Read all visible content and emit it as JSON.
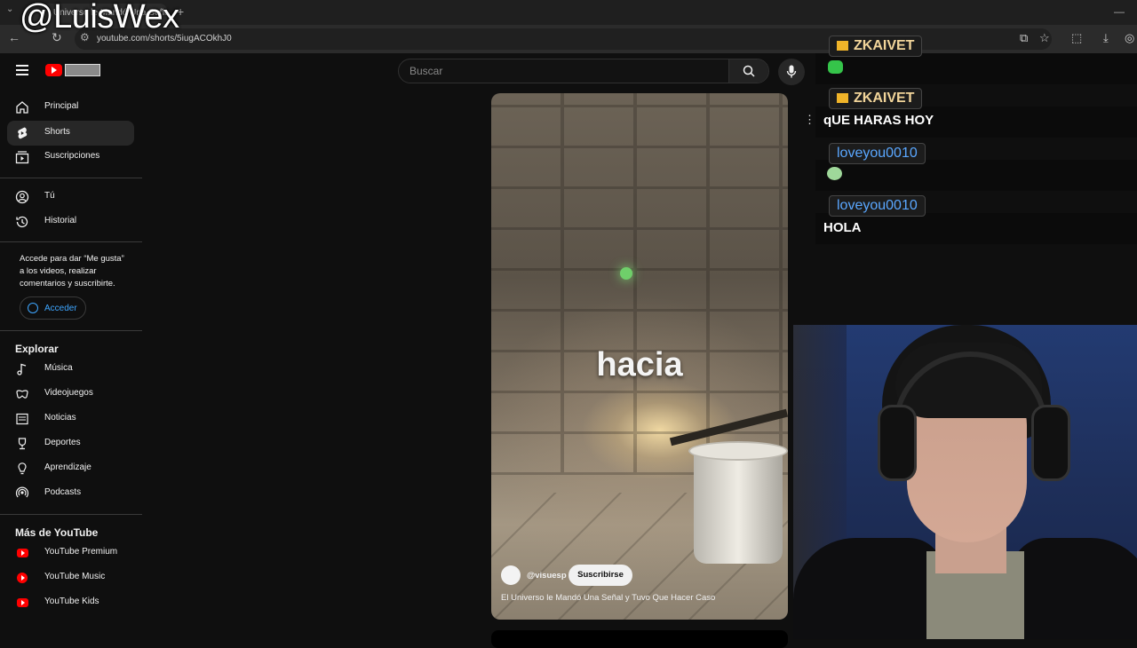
{
  "watermark": "@LuisWex",
  "browser": {
    "tab_title": "Universo le Mandó Una Señal",
    "url": "youtube.com/shorts/5iugACOkhJ0"
  },
  "youtube": {
    "search_placeholder": "Buscar",
    "sidebar": {
      "primary": [
        {
          "label": "Principal",
          "icon": "home-icon"
        },
        {
          "label": "Shorts",
          "icon": "shorts-icon",
          "active": true
        },
        {
          "label": "Suscripciones",
          "icon": "subscriptions-icon"
        }
      ],
      "you": [
        {
          "label": "Tú",
          "icon": "user-icon"
        },
        {
          "label": "Historial",
          "icon": "history-icon"
        }
      ],
      "signin_text": "Accede para dar “Me gusta” a los videos, realizar comentarios y suscribirte.",
      "signin_button": "Acceder",
      "explore_heading": "Explorar",
      "explore": [
        {
          "label": "Música",
          "icon": "music-icon"
        },
        {
          "label": "Videojuegos",
          "icon": "gaming-icon"
        },
        {
          "label": "Noticias",
          "icon": "news-icon"
        },
        {
          "label": "Deportes",
          "icon": "trophy-icon"
        },
        {
          "label": "Aprendizaje",
          "icon": "lightbulb-icon"
        },
        {
          "label": "Podcasts",
          "icon": "podcast-icon"
        }
      ],
      "more_heading": "Más de YouTube",
      "more": [
        {
          "label": "YouTube Premium",
          "icon": "youtube-premium-icon"
        },
        {
          "label": "YouTube Music",
          "icon": "youtube-music-icon"
        },
        {
          "label": "YouTube Kids",
          "icon": "youtube-kids-icon"
        }
      ]
    },
    "short": {
      "caption_word": "hacia",
      "channel": "@visuesp",
      "subscribe_label": "Suscribirse",
      "title": "El Universo le Mandó Una Señal y Tuvo Que Hacer Caso"
    }
  },
  "stream_chat": [
    {
      "user": "ZKAIVET",
      "badge": "crown-badge-icon",
      "message": "",
      "emote": "green-emote-icon"
    },
    {
      "user": "ZKAIVET",
      "badge": "crown-badge-icon",
      "message": "qUE HARAS HOY"
    },
    {
      "user": "loveyou0010",
      "message": "",
      "emote": "skull-emote-icon"
    },
    {
      "user": "loveyou0010",
      "message": "HOLA"
    }
  ],
  "colors": {
    "yt_red": "#ff0000",
    "link_blue": "#3ea6ff",
    "chat_gold": "#f2d59a",
    "chat_blue": "#5aa7ff"
  }
}
